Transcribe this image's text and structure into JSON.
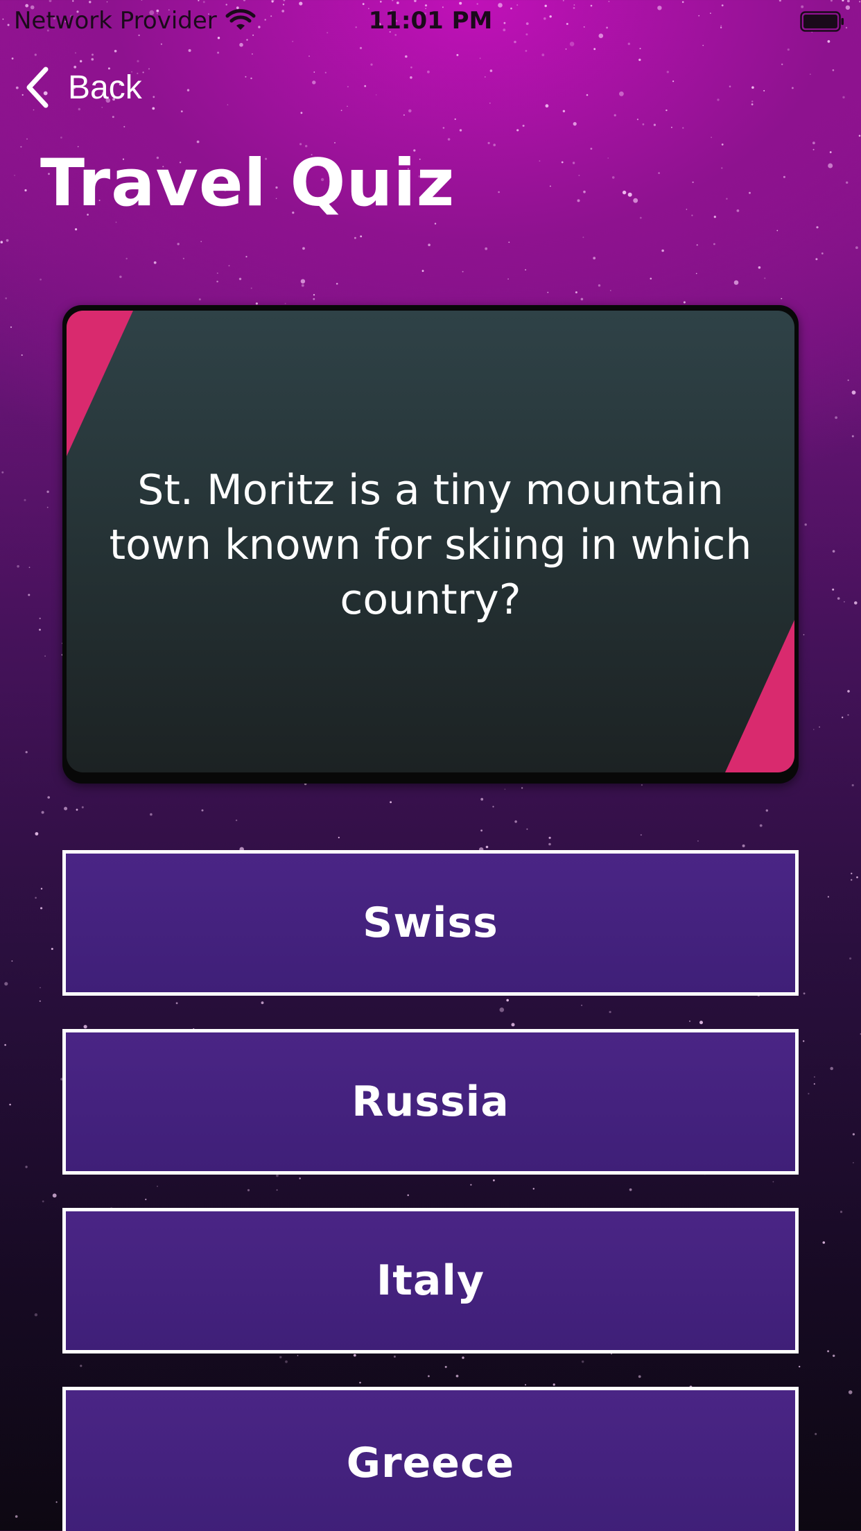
{
  "status_bar": {
    "carrier": "Network Provider",
    "time": "11:01 PM",
    "wifi_icon": "wifi-icon",
    "battery_icon": "battery-icon"
  },
  "nav": {
    "back_label": "Back",
    "back_icon": "chevron-left-icon"
  },
  "page_title": "Travel Quiz",
  "question": {
    "text": "St. Moritz is a tiny mountain town known for skiing in which country?",
    "accent_color": "#d92a6e"
  },
  "answers": [
    {
      "label": "Swiss"
    },
    {
      "label": "Russia"
    },
    {
      "label": "Italy"
    },
    {
      "label": "Greece"
    }
  ],
  "colors": {
    "answer_fill": "#45227f",
    "answer_border": "#ffffff",
    "card_fill": "#263437",
    "background_top": "#9a1596",
    "background_bottom": "#0d0812"
  }
}
